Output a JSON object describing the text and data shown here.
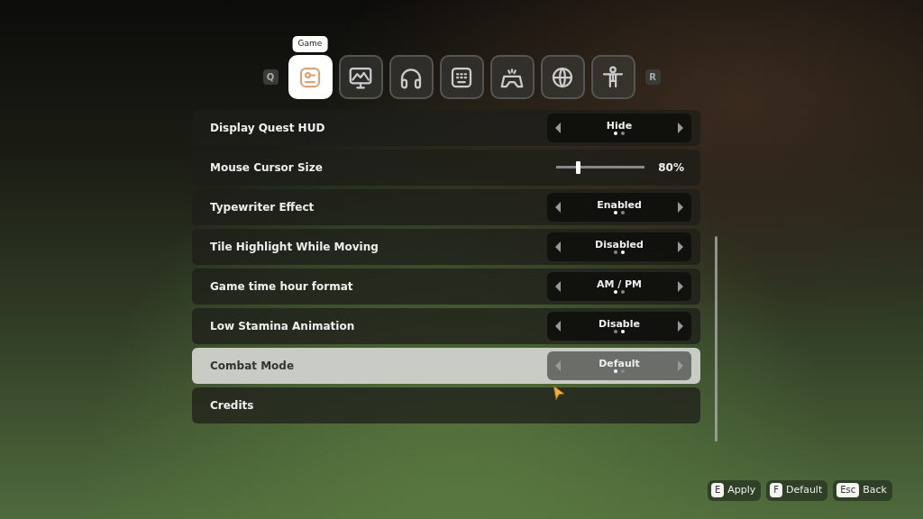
{
  "tab_bar": {
    "prev_key": "Q",
    "next_key": "R",
    "tooltip": "Game",
    "tabs": [
      {
        "kind": "game",
        "selected": true
      },
      {
        "kind": "display",
        "selected": false
      },
      {
        "kind": "audio",
        "selected": false
      },
      {
        "kind": "keyboard",
        "selected": false
      },
      {
        "kind": "controller",
        "selected": false
      },
      {
        "kind": "language",
        "selected": false
      },
      {
        "kind": "accessibility",
        "selected": false
      }
    ]
  },
  "settings": [
    {
      "kind": "selector",
      "label": "Display Quest HUD",
      "value": "Hide",
      "selected": false,
      "dots": [
        {
          "selected": true
        },
        {
          "selected": false
        }
      ]
    },
    {
      "kind": "slider",
      "label": "Mouse Cursor Size",
      "level": 0.22,
      "reading": "80%",
      "selected": false
    },
    {
      "kind": "selector",
      "label": "Typewriter Effect",
      "value": "Enabled",
      "selected": false,
      "dots": [
        {
          "selected": true
        },
        {
          "selected": false
        }
      ]
    },
    {
      "kind": "selector",
      "label": "Tile Highlight While Moving",
      "value": "Disabled",
      "selected": false,
      "dots": [
        {
          "selected": false
        },
        {
          "selected": true
        }
      ]
    },
    {
      "kind": "selector",
      "label": "Game time hour format",
      "value": "AM / PM",
      "selected": false,
      "dots": [
        {
          "selected": true
        },
        {
          "selected": false
        }
      ]
    },
    {
      "kind": "selector",
      "label": "Low Stamina Animation",
      "value": "Disable",
      "selected": false,
      "dots": [
        {
          "selected": false
        },
        {
          "selected": true
        }
      ]
    },
    {
      "kind": "selector",
      "label": "Combat Mode",
      "value": "Default",
      "selected": true,
      "dots": [
        {
          "selected": true
        },
        {
          "selected": false
        }
      ]
    },
    {
      "kind": "link",
      "label": "Credits",
      "selected": false
    }
  ],
  "footer": [
    {
      "key": "E",
      "label": "Apply"
    },
    {
      "key": "F",
      "label": "Default"
    },
    {
      "key": "Esc",
      "label": "Back"
    }
  ]
}
